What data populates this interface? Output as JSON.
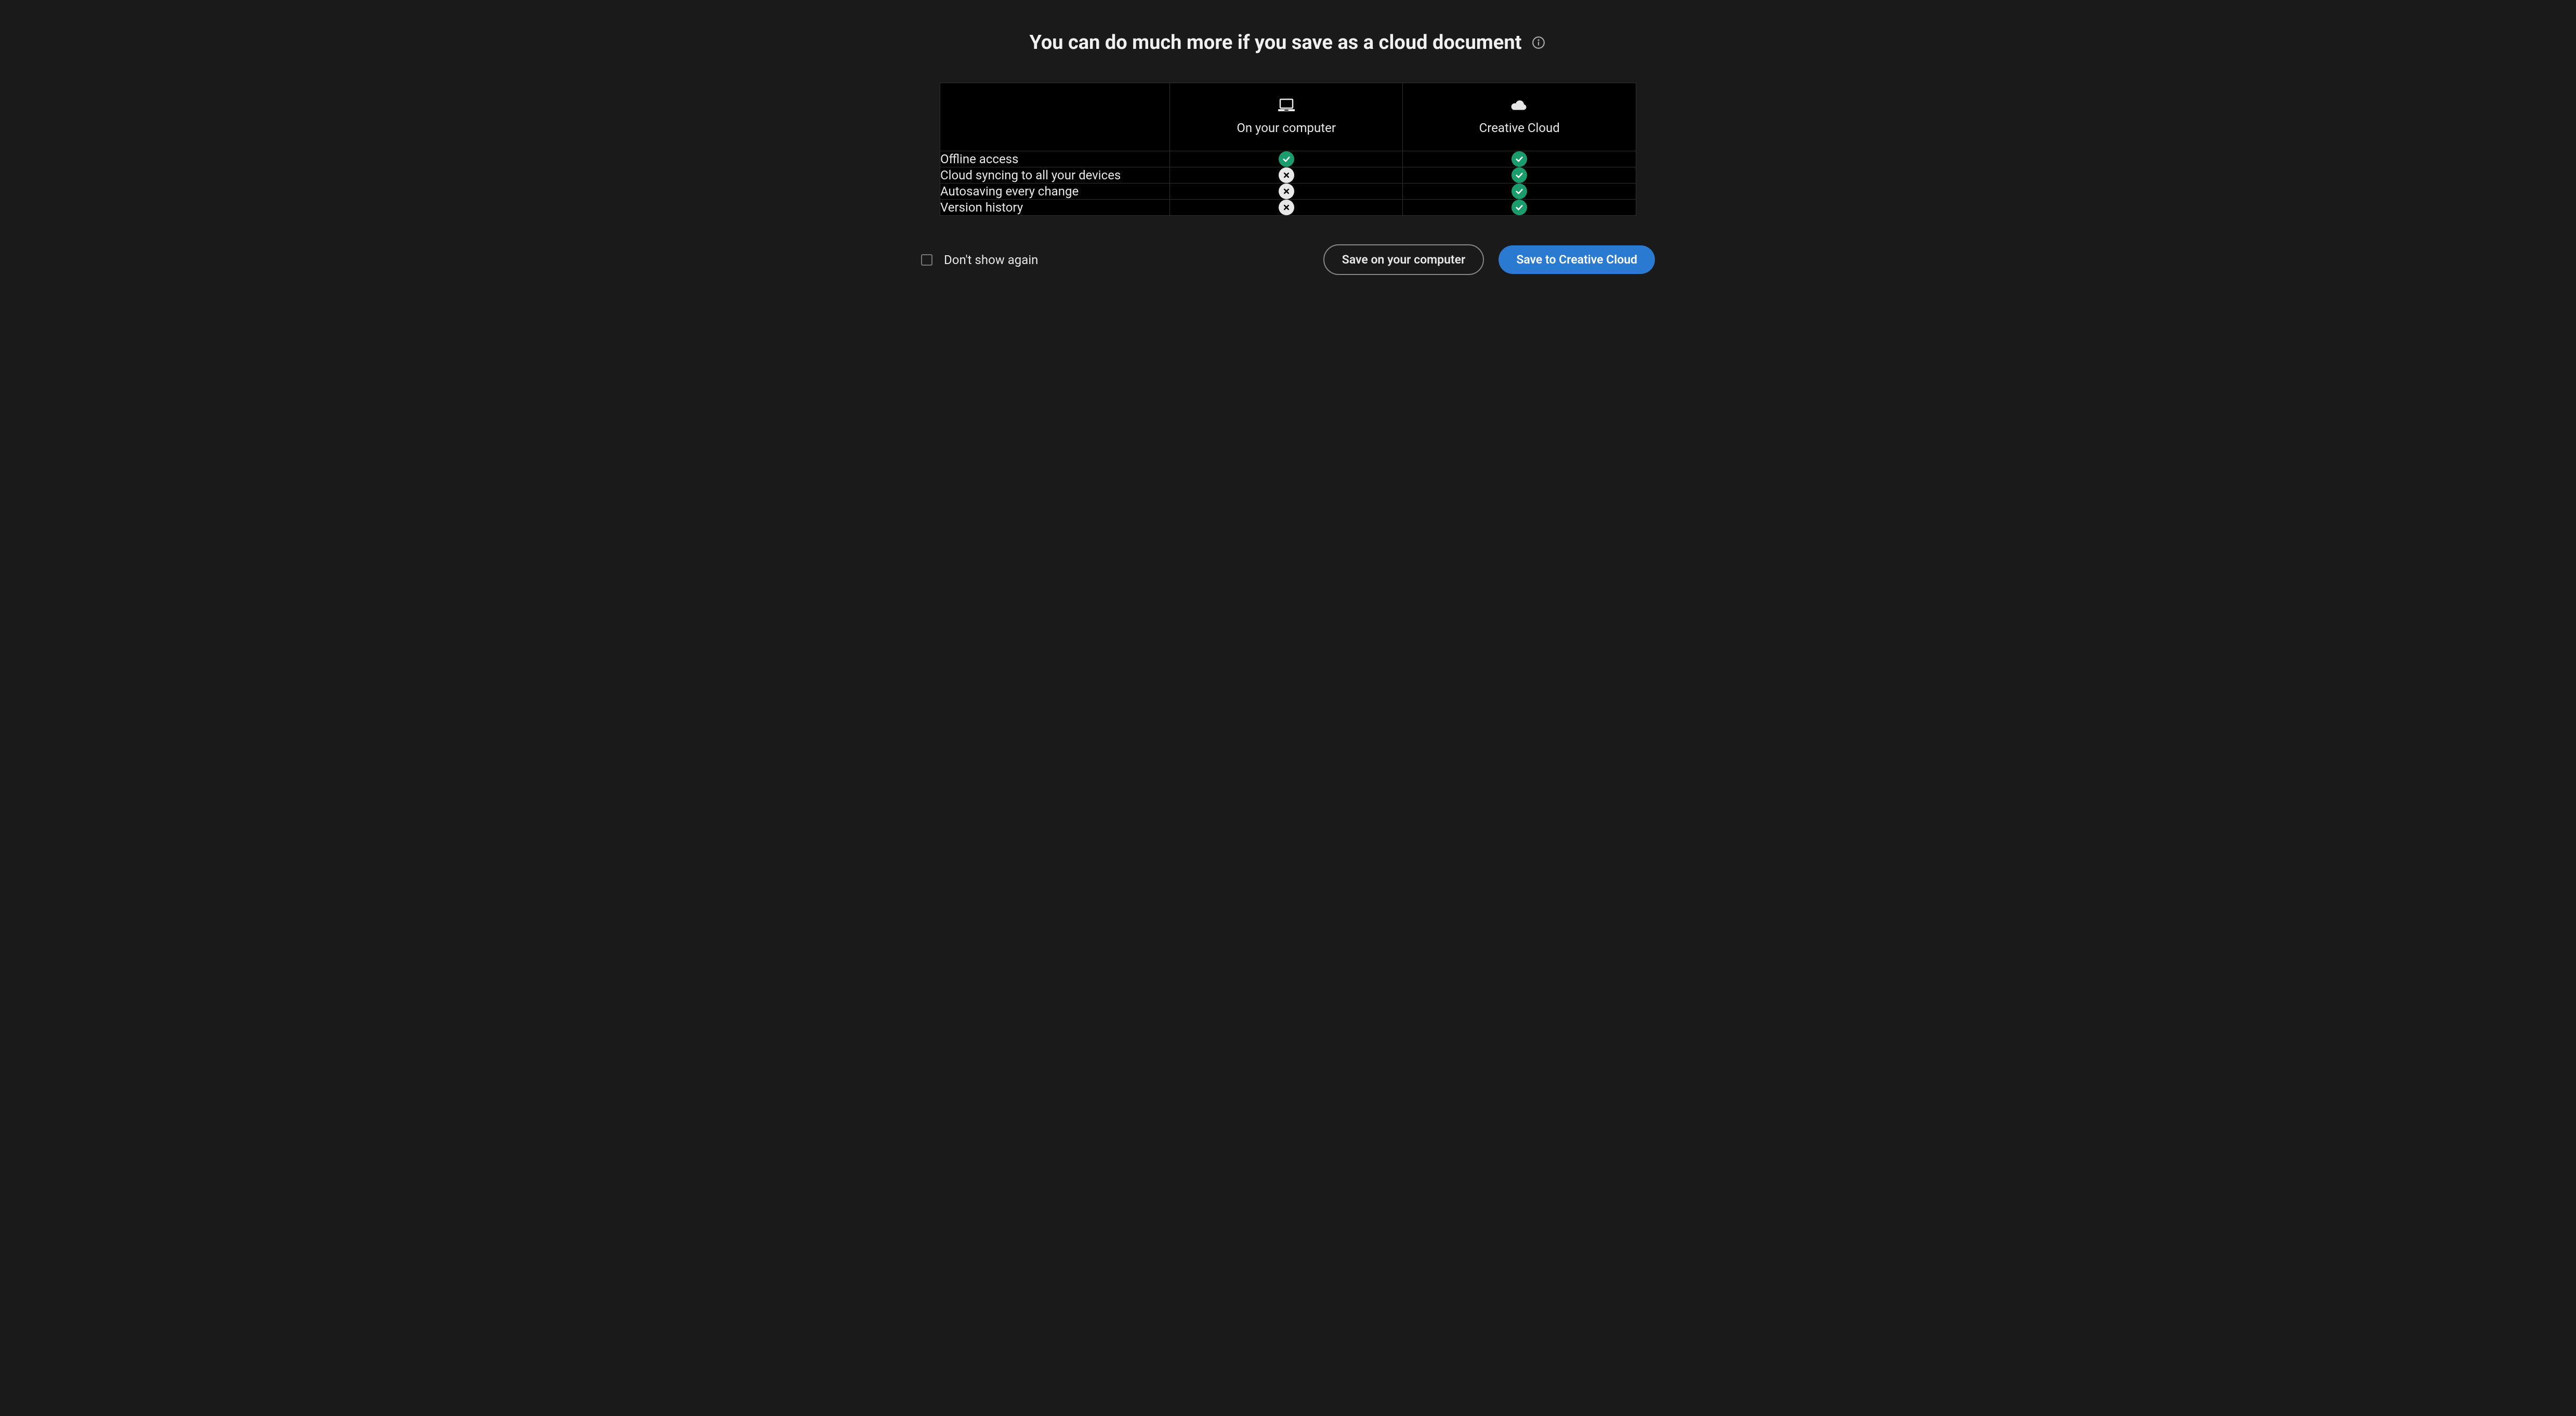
{
  "title": "You can do much more if you save as a cloud document",
  "columns": {
    "local": "On your computer",
    "cloud": "Creative Cloud"
  },
  "features": [
    {
      "label": "Offline access",
      "local": true,
      "cloud": true
    },
    {
      "label": "Cloud syncing to all your devices",
      "local": false,
      "cloud": true
    },
    {
      "label": "Autosaving every change",
      "local": false,
      "cloud": true
    },
    {
      "label": "Version history",
      "local": false,
      "cloud": true
    }
  ],
  "footer": {
    "dont_show_label": "Don't show again",
    "secondary_button": "Save on your computer",
    "primary_button": "Save to Creative Cloud"
  },
  "icons": {
    "info": "info-icon",
    "local": "laptop-icon",
    "cloud": "cloud-icon",
    "yes": "check-icon",
    "no": "cross-icon"
  },
  "colors": {
    "accent_green": "#1b9c6c",
    "accent_blue": "#2a7ad1",
    "background": "#1a1a1a",
    "table_bg": "#000000",
    "border": "#2d2d2d"
  }
}
